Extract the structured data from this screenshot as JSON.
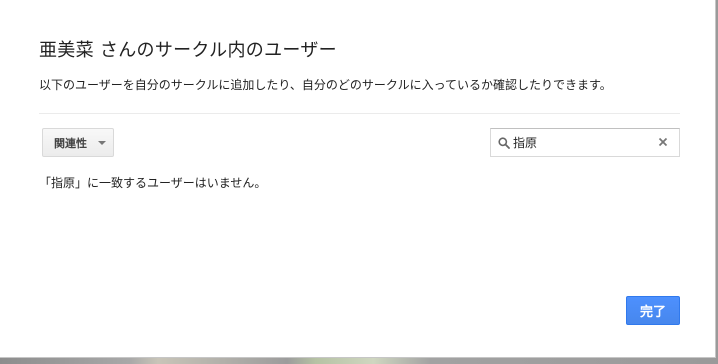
{
  "dialog": {
    "title": "亜美菜 さんのサークル内のユーザー",
    "subtitle": "以下のユーザーを自分のサークルに追加したり、自分のどのサークルに入っているか確認したりできます。"
  },
  "sort": {
    "selected": "関連性",
    "icon": "chevron-down-icon"
  },
  "search": {
    "value": "指原",
    "icon": "search-icon",
    "clear_icon": "close-icon"
  },
  "results": {
    "message": "「指原」に一致するユーザーはいません。"
  },
  "footer": {
    "done_label": "完了"
  },
  "colors": {
    "primary_button": "#4d90fe",
    "text": "#222222",
    "divider": "#ebebeb"
  }
}
